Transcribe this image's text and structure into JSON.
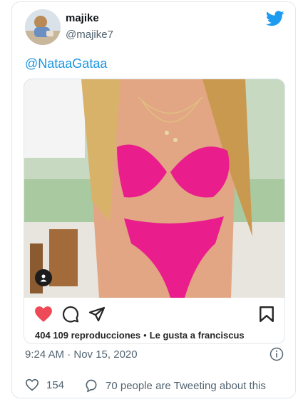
{
  "author": {
    "display_name": "majike",
    "handle": "@majike7"
  },
  "tweet": {
    "text": "@NataaGataa"
  },
  "embed": {
    "views": "404 109 reproducciones",
    "separator": "•",
    "liked_by": "Le gusta a franciscus",
    "like_color": "#ed4956"
  },
  "meta": {
    "timestamp": "9:24 AM · Nov 15, 2020"
  },
  "footer": {
    "like_count": "154",
    "conversation": "70 people are Tweeting about this"
  },
  "colors": {
    "brand": "#1d9bf0",
    "link": "#1b95e0",
    "muted": "#536471"
  },
  "icons": [
    "twitter-bird-icon",
    "user-tag-icon",
    "heart-icon",
    "comment-icon",
    "share-icon",
    "bookmark-icon",
    "info-icon",
    "reply-bubble-icon"
  ]
}
